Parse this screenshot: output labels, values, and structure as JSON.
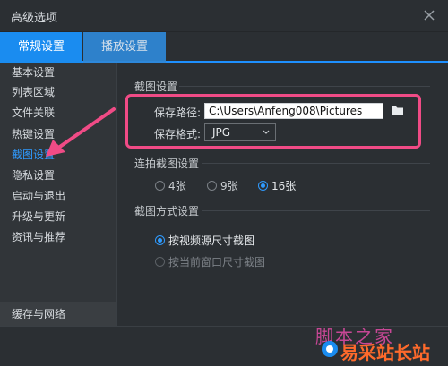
{
  "window": {
    "title": "高级选项"
  },
  "tabs": [
    {
      "label": "常规设置",
      "active": true
    },
    {
      "label": "播放设置",
      "active": false
    }
  ],
  "sidebar": {
    "items": [
      {
        "label": "基本设置"
      },
      {
        "label": "列表区域"
      },
      {
        "label": "文件关联"
      },
      {
        "label": "热键设置"
      },
      {
        "label": "截图设置",
        "active": true
      },
      {
        "label": "隐私设置"
      },
      {
        "label": "启动与退出"
      },
      {
        "label": "升级与更新"
      },
      {
        "label": "资讯与推荐"
      }
    ],
    "bottom_item": "缓存与网络"
  },
  "screenshot": {
    "section_title": "截图设置",
    "path_label": "保存路径:",
    "path_value": "C:\\Users\\Anfeng008\\Pictures",
    "format_label": "保存格式:",
    "format_value": "JPG"
  },
  "burst": {
    "section_title": "连拍截图设置",
    "options": [
      {
        "label": "4张",
        "checked": false
      },
      {
        "label": "9张",
        "checked": false
      },
      {
        "label": "16张",
        "checked": true
      }
    ]
  },
  "mode": {
    "section_title": "截图方式设置",
    "options": [
      {
        "label": "按视频源尺寸截图",
        "checked": true,
        "disabled": false
      },
      {
        "label": "按当前窗口尺寸截图",
        "checked": false,
        "disabled": true
      }
    ]
  },
  "watermark": {
    "line1": "脚本之家",
    "line2": "易采站长站"
  },
  "colors": {
    "accent": "#1a8cf0",
    "highlight": "#f04b86",
    "background": "#2b2f33"
  }
}
